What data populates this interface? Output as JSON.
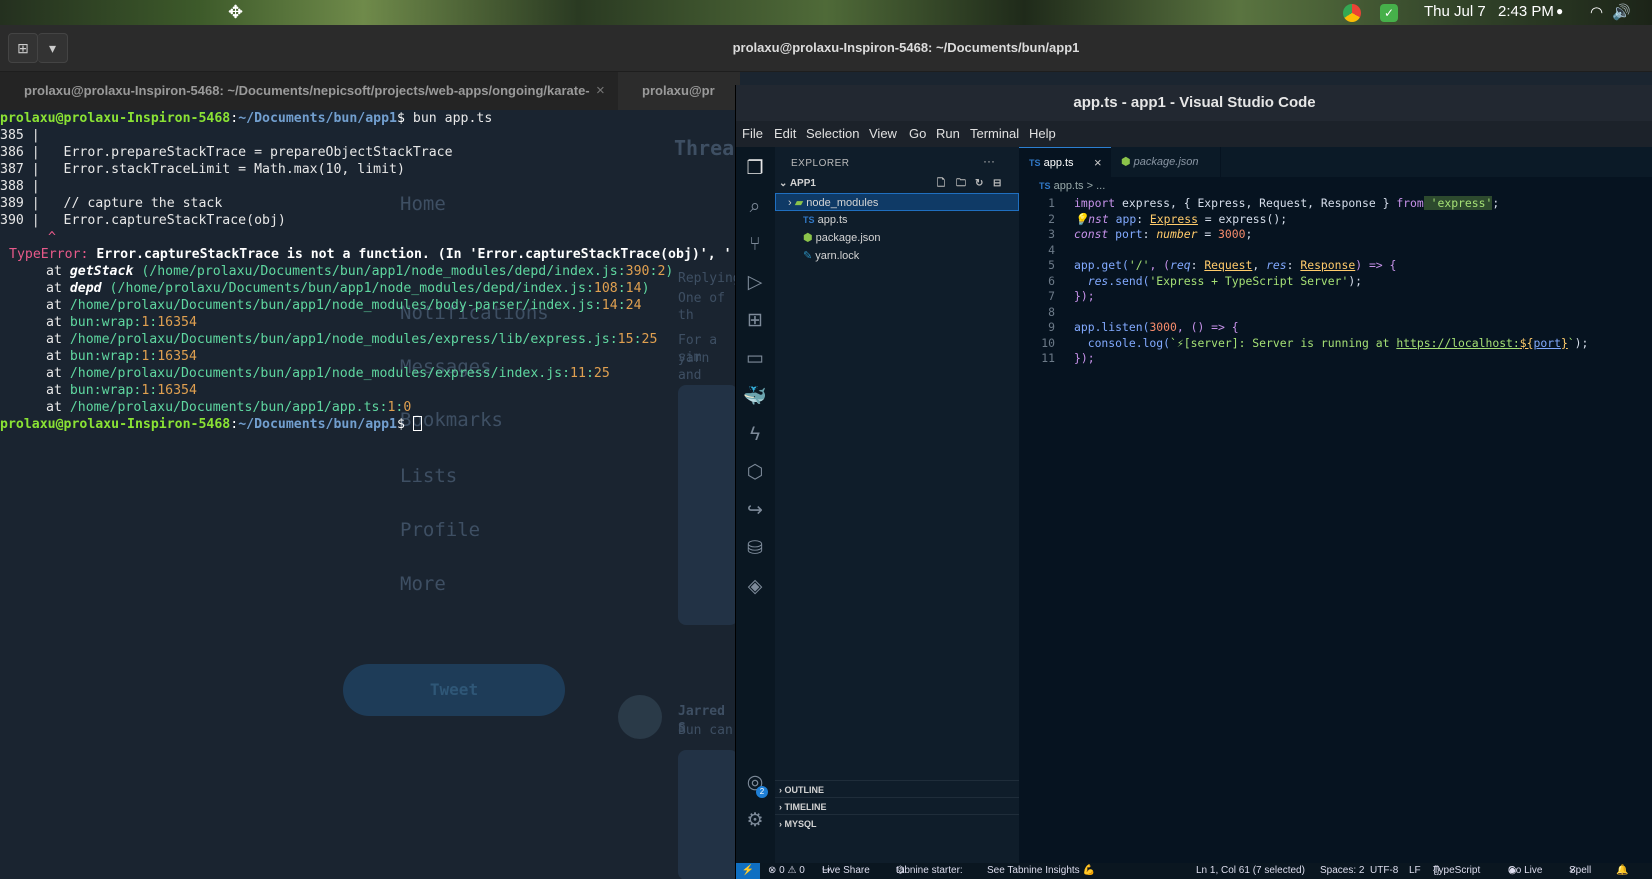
{
  "topbar": {
    "date": "Thu Jul 7",
    "time": "2:43 PM"
  },
  "terminal": {
    "window_title": "prolaxu@prolaxu-Inspiron-5468: ~/Documents/bun/app1",
    "tabs": [
      {
        "label": "prolaxu@prolaxu-Inspiron-5468: ~/Documents/nepicsoft/projects/web-apps/ongoing/karate-..."
      },
      {
        "label": "prolaxu@pr"
      }
    ],
    "tab_close": "×",
    "prompt_user": "prolaxu@prolaxu-Inspiron-5468",
    "prompt_path": "~/Documents/bun/app1",
    "command": "bun app.ts",
    "source_lines": [
      "385 |",
      "386 |   Error.prepareStackTrace = prepareObjectStackTrace",
      "387 |   Error.stackTraceLimit = Math.max(10, limit)",
      "388 |",
      "389 |   // capture the stack",
      "390 |   Error.captureStackTrace(obj)"
    ],
    "caret": "^",
    "error_type": "TypeError:",
    "error_message": "Error.captureStackTrace is not a function. (In 'Error.captureStackTrace(obj)', '",
    "stack": [
      {
        "fn": "getStack",
        "path": "/home/prolaxu/Documents/bun/app1/node_modules/depd/index.js",
        "line": "390",
        "col": "2"
      },
      {
        "fn": "depd",
        "path": "/home/prolaxu/Documents/bun/app1/node_modules/depd/index.js",
        "line": "108",
        "col": "14"
      },
      {
        "fn": "",
        "path": "/home/prolaxu/Documents/bun/app1/node_modules/body-parser/index.js",
        "line": "14",
        "col": "24"
      },
      {
        "fn": "",
        "path": "bun:wrap",
        "line": "1",
        "col": "16354"
      },
      {
        "fn": "",
        "path": "/home/prolaxu/Documents/bun/app1/node_modules/express/lib/express.js",
        "line": "15",
        "col": "25"
      },
      {
        "fn": "",
        "path": "bun:wrap",
        "line": "1",
        "col": "16354"
      },
      {
        "fn": "",
        "path": "/home/prolaxu/Documents/bun/app1/node_modules/express/index.js",
        "line": "11",
        "col": "25"
      },
      {
        "fn": "",
        "path": "bun:wrap",
        "line": "1",
        "col": "16354"
      },
      {
        "fn": "",
        "path": "/home/prolaxu/Documents/bun/app1/app.ts",
        "line": "1",
        "col": "0"
      }
    ]
  },
  "background_app": {
    "nav": [
      "Home",
      "Notifications",
      "Messages",
      "Bookmarks",
      "Lists",
      "Profile",
      "More"
    ],
    "tweet_button": "Tweet",
    "heading": "Threa",
    "snippets": [
      "Replying",
      "One of th",
      "For a sim",
      "yarn and",
      "Jarred S",
      "Bun can"
    ]
  },
  "vscode": {
    "title": "app.ts - app1 - Visual Studio Code",
    "menu": [
      "File",
      "Edit",
      "Selection",
      "View",
      "Go",
      "Run",
      "Terminal",
      "Help"
    ],
    "explorer_title": "EXPLORER",
    "explorer_more": "···",
    "project": "APP1",
    "files": [
      "node_modules",
      "app.ts",
      "package.json",
      "yarn.lock"
    ],
    "panels": [
      "OUTLINE",
      "TIMELINE",
      "MYSQL"
    ],
    "tabs": [
      {
        "label": "app.ts",
        "active": true
      },
      {
        "label": "package.json",
        "active": false
      }
    ],
    "breadcrumb": "app.ts > ...",
    "account_badge": "2",
    "status": {
      "remote": "⚡",
      "errors": "⊗ 0 ⚠ 0",
      "live_share": "Live Share",
      "tabnine": "tabnine starter:",
      "tabnine_insights": "See Tabnine Insights 💪",
      "position": "Ln 1, Col 61 (7 selected)",
      "spaces": "Spaces: 2",
      "encoding": "UTF-8",
      "eol": "LF",
      "language": "TypeScript",
      "go_live": "Go Live",
      "spell": "Spell"
    },
    "code": {
      "l1": {
        "a": "import",
        "b": " express, { Express, Request, Response } ",
        "c": "from",
        "d": " 'express'",
        "e": ";"
      },
      "l2": {
        "a": "💡nst ",
        "b": "app",
        "c": ": ",
        "d": "Express",
        "e": " = express();"
      },
      "l3": {
        "a": "const",
        "b": " port",
        "c": ": ",
        "d": "number",
        "e": " = ",
        "f": "3000",
        "g": ";"
      },
      "l5": {
        "a": "app.get(",
        "b": "'/'",
        "c": ", (",
        "d": "req",
        "e": ": ",
        "f": "Request",
        "g": ", ",
        "h": "res",
        "i": ": ",
        "j": "Response",
        "k": ") => {"
      },
      "l6": {
        "a": "  res",
        "b": ".send(",
        "c": "'Express + TypeScript Server'",
        "d": ");"
      },
      "l7": "});",
      "l9": {
        "a": "app.listen(",
        "b": "3000",
        "c": ", () => {"
      },
      "l10": {
        "a": "  console.log(",
        "b": "`⚡[server]: Server is running at ",
        "c": "https://localhost:",
        "d": "${",
        "e": "port",
        "f": "}",
        "g": "`",
        "h": ");"
      },
      "l11": "});"
    }
  },
  "colors": {
    "terminal_bg": "#1a2430",
    "prompt_user": "#8ae234",
    "prompt_path": "#729fcf",
    "error": "#e85a8a",
    "vscode_bg": "#061320"
  }
}
